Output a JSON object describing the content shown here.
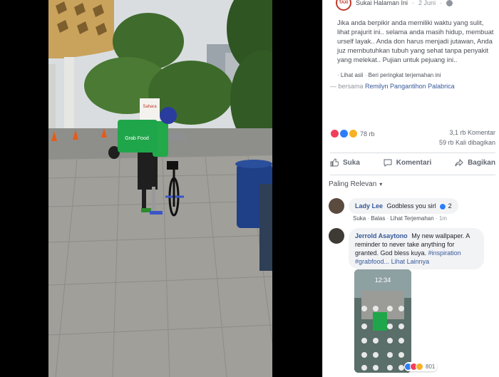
{
  "post": {
    "page_logo": "TAXI",
    "like_page": "Sukai Halaman Ini",
    "date": "2 Juni",
    "text": "Jika anda berpikir anda memiliki waktu yang sulit, lihat prajurit ini.. selama anda masih hidup, membuat urself layak.. Anda don harus menjadi jutawan, Anda juz membutuhkan tubuh yang sehat tanpa penyakit yang melekat.. Pujian untuk pejuang ini..",
    "see_original": "Lihat asli",
    "translation_feedback": "Beri peringkat terjemahan ini",
    "with_prefix": "— bersama",
    "with_name": "Remilyn Pangantihon Palabrica"
  },
  "stats": {
    "reactions_count": "78 rb",
    "comments": "3,1 rb Komentar",
    "shares": "59 rb Kali dibagikan"
  },
  "actions": {
    "like": "Suka",
    "comment": "Komentari",
    "share": "Bagikan"
  },
  "relevance": {
    "label": "Paling Relevan"
  },
  "comments": [
    {
      "author": "Lady Lee",
      "text": "Godbless you sirl",
      "reaction_count": "2",
      "like": "Suka",
      "reply": "Balas",
      "see_translation": "Lihat Terjemahan",
      "time": "1m"
    },
    {
      "author": "Jerrold Asaytono",
      "text": "My new wallpaper. A reminder to never take anything for granted. God bless kuya.",
      "tags": "#inspiration #grabfood...",
      "see_more": "Lihat Lainnya",
      "reaction_count": "801",
      "phone_time": "12:34"
    }
  ],
  "colors": {
    "link": "#365899",
    "grab_green": "#1fa64a",
    "love": "#f33e58",
    "like": "#2d7ff9",
    "sad": "#f7b125"
  },
  "photo": {
    "sign_text": "Sahara",
    "bag_text": "Grab Food"
  }
}
